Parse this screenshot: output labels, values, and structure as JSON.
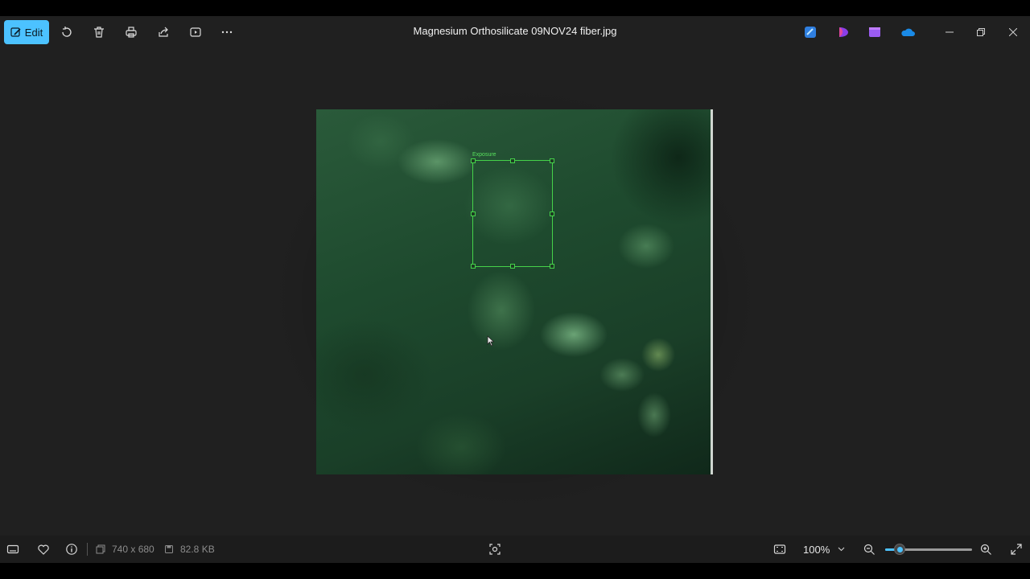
{
  "toolbar": {
    "edit_label": "Edit",
    "buttons": [
      "rotate-icon",
      "delete-icon",
      "print-icon",
      "share-icon",
      "slideshow-icon",
      "more-icon"
    ]
  },
  "window": {
    "title": "Magnesium Orthosilicate 09NOV24 fiber.jpg"
  },
  "image": {
    "overlay_label": "Exposure",
    "accent_color": "#45d24a"
  },
  "statusbar": {
    "dimensions": "740 x 680",
    "file_size": "82.8 KB",
    "zoom_level": "100%",
    "zoom_slider_fraction": 0.17
  },
  "colors": {
    "accent": "#4cc2ff",
    "background": "#202020"
  }
}
